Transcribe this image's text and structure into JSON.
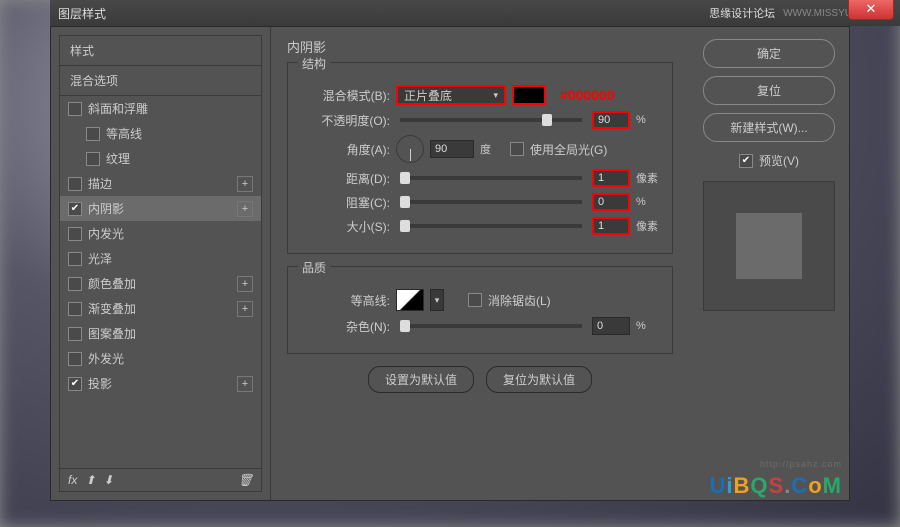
{
  "window": {
    "title": "图层样式",
    "forum": "思缘设计论坛",
    "url": "WWW.MISSYUAN.COM"
  },
  "left": {
    "header1": "样式",
    "header2": "混合选项",
    "items": [
      {
        "label": "斜面和浮雕",
        "checked": false,
        "plus": false,
        "indent": false
      },
      {
        "label": "等高线",
        "checked": false,
        "plus": false,
        "indent": true
      },
      {
        "label": "纹理",
        "checked": false,
        "plus": false,
        "indent": true
      },
      {
        "label": "描边",
        "checked": false,
        "plus": true,
        "indent": false
      },
      {
        "label": "内阴影",
        "checked": true,
        "plus": true,
        "indent": false,
        "selected": true
      },
      {
        "label": "内发光",
        "checked": false,
        "plus": false,
        "indent": false
      },
      {
        "label": "光泽",
        "checked": false,
        "plus": false,
        "indent": false
      },
      {
        "label": "颜色叠加",
        "checked": false,
        "plus": true,
        "indent": false
      },
      {
        "label": "渐变叠加",
        "checked": false,
        "plus": true,
        "indent": false
      },
      {
        "label": "图案叠加",
        "checked": false,
        "plus": false,
        "indent": false
      },
      {
        "label": "外发光",
        "checked": false,
        "plus": false,
        "indent": false
      },
      {
        "label": "投影",
        "checked": true,
        "plus": true,
        "indent": false
      }
    ],
    "fx": "fx"
  },
  "mid": {
    "title": "内阴影",
    "group1": "结构",
    "blend_label": "混合模式(B):",
    "blend_value": "正片叠底",
    "hex": "#000000",
    "opacity_label": "不透明度(O):",
    "opacity_value": "90",
    "opacity_unit": "%",
    "angle_label": "角度(A):",
    "angle_value": "90",
    "angle_unit": "度",
    "global_label": "使用全局光(G)",
    "distance_label": "距离(D):",
    "distance_value": "1",
    "distance_unit": "像素",
    "choke_label": "阻塞(C):",
    "choke_value": "0",
    "choke_unit": "%",
    "size_label": "大小(S):",
    "size_value": "1",
    "size_unit": "像素",
    "group2": "品质",
    "contour_label": "等高线:",
    "aa_label": "消除锯齿(L)",
    "noise_label": "杂色(N):",
    "noise_value": "0",
    "noise_unit": "%",
    "btn_default": "设置为默认值",
    "btn_reset": "复位为默认值"
  },
  "right": {
    "ok": "确定",
    "cancel": "复位",
    "newstyle": "新建样式(W)...",
    "preview": "预览(V)"
  },
  "watermark_url": "http://psahz.com"
}
